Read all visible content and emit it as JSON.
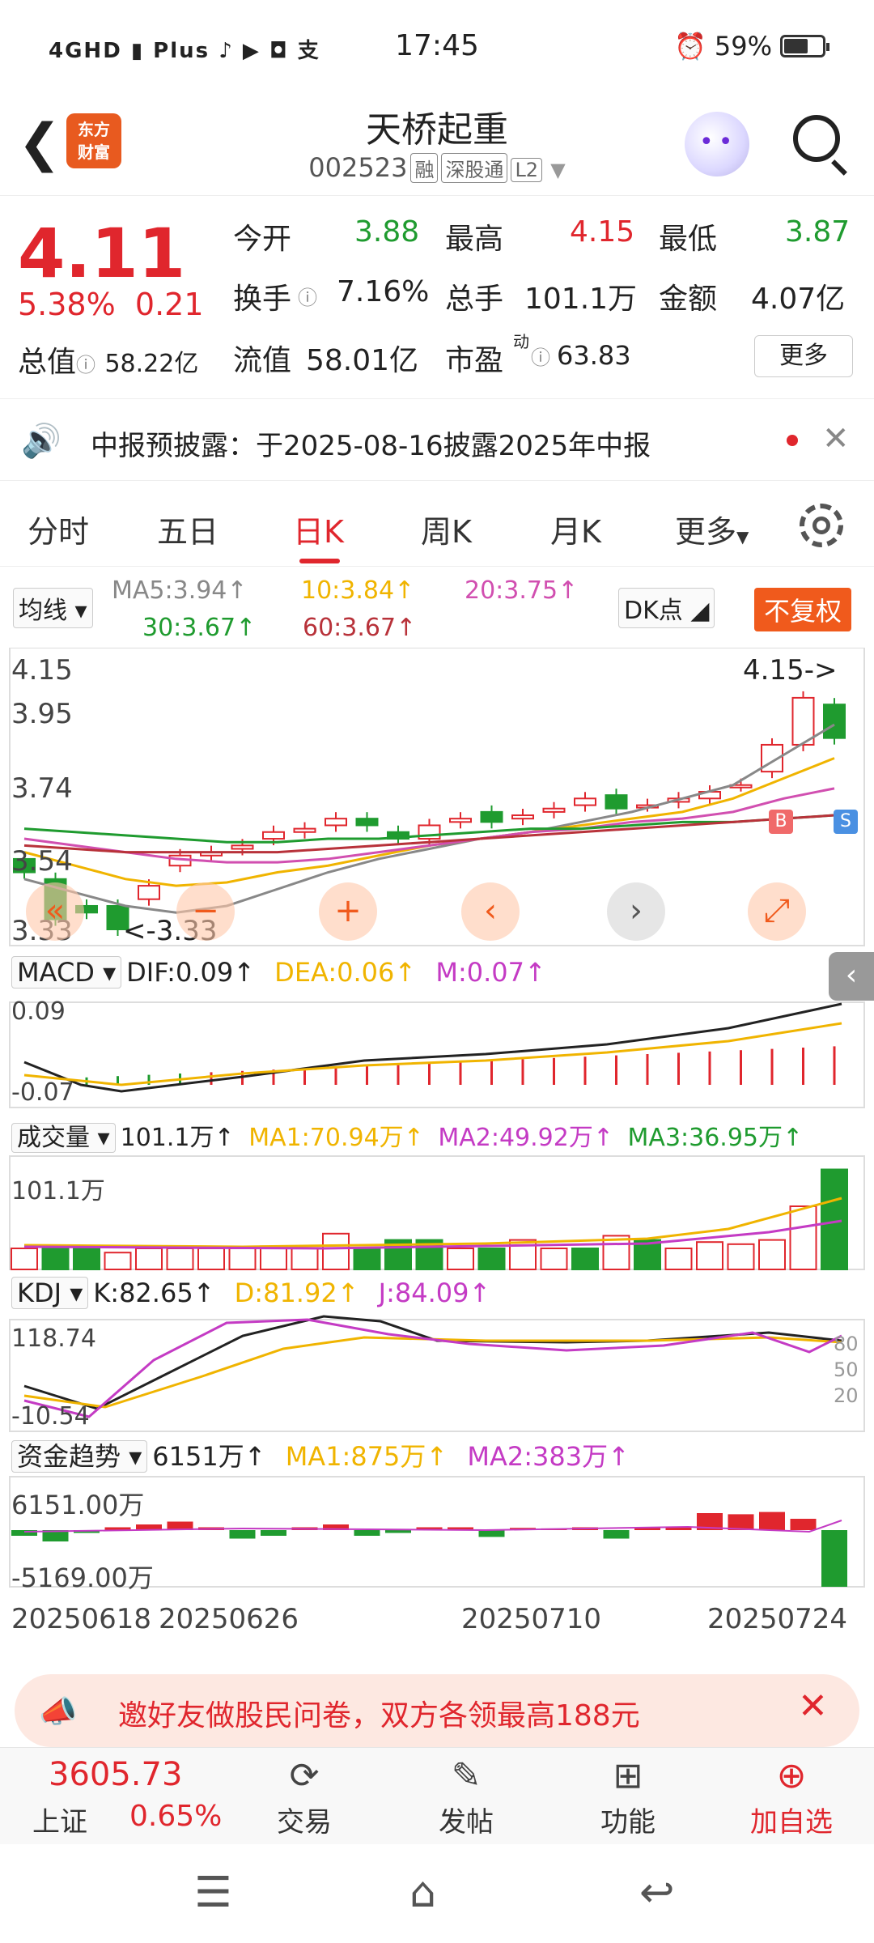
{
  "status": {
    "left_icons": "4GHD ▮ Plus ♪ ▶ ◘ 支",
    "time": "17:45",
    "battery": "59%"
  },
  "header": {
    "back_glyph": "❮",
    "logo_line1": "东方",
    "logo_line2": "财富",
    "stock_name": "天桥起重",
    "stock_code": "002523",
    "tag_rong": "融",
    "tag_sgt": "深股通",
    "tag_l2": "L2"
  },
  "quote": {
    "price": "4.11",
    "change_pct": "5.38%",
    "change_abs": "0.21",
    "total_value_label": "总值",
    "total_value": "58.22亿",
    "open_label": "今开",
    "open": "3.88",
    "high_label": "最高",
    "high": "4.15",
    "low_label": "最低",
    "low": "3.87",
    "turnover_label": "换手",
    "turnover": "7.16%",
    "volume_label": "总手",
    "volume": "101.1万",
    "amount_label": "金额",
    "amount": "4.07亿",
    "float_label": "流值",
    "float_value": "58.01亿",
    "pe_label": "市盈",
    "pe_sup": "动",
    "pe": "63.83",
    "more": "更多"
  },
  "notice": {
    "text": "中报预披露：于2025-08-16披露2025年中报"
  },
  "tabs": [
    "分时",
    "五日",
    "日K",
    "周K",
    "月K",
    "更多"
  ],
  "ma": {
    "selector": "均线",
    "ma5": "MA5:3.94↑",
    "ma10": "10:3.84↑",
    "ma20": "20:3.75↑",
    "ma30": "30:3.67↑",
    "ma60": "60:3.67↑",
    "dk": "DK点",
    "adjust": "不复权"
  },
  "kline_axis": [
    "4.15",
    "3.95",
    "3.74",
    "3.54",
    "3.33"
  ],
  "kline_annot": {
    "high": "4.15->",
    "low": "<-3.33",
    "buy": "B",
    "sell": "S"
  },
  "macd": {
    "selector": "MACD",
    "dif": "DIF:0.09↑",
    "dea": "DEA:0.06↑",
    "m": "M:0.07↑",
    "axis_top": "0.09",
    "axis_bottom": "-0.07"
  },
  "vol": {
    "selector": "成交量",
    "value": "101.1万↑",
    "ma1": "MA1:70.94万↑",
    "ma2": "MA2:49.92万↑",
    "ma3": "MA3:36.95万↑",
    "axis_top": "101.1万"
  },
  "kdj": {
    "selector": "KDJ",
    "k": "K:82.65↑",
    "d": "D:81.92↑",
    "j": "J:84.09↑",
    "axis_top": "118.74",
    "axis_bottom": "-10.54",
    "lv80": "80",
    "lv50": "50",
    "lv20": "20"
  },
  "fund": {
    "selector": "资金趋势",
    "value": "6151万↑",
    "ma1": "MA1:875万↑",
    "ma2": "MA2:383万↑",
    "axis_top": "6151.00万",
    "axis_bottom": "-5169.00万"
  },
  "dates": [
    "20250618",
    "20250626",
    "20250710",
    "20250724"
  ],
  "banner": {
    "text": "邀好友做股民问卷，双方各领最高188元"
  },
  "bottom": {
    "index_value": "3605.73",
    "index_name": "上证",
    "index_change": "0.65%",
    "nav": [
      "交易",
      "发帖",
      "功能",
      "加自选"
    ]
  },
  "colors": {
    "up": "#e0262d",
    "down": "#1f9b2f",
    "ma5": "#888888",
    "ma10": "#f0b400",
    "ma20": "#d14fb0",
    "ma30": "#1f9b2f",
    "ma60": "#b8323a"
  }
}
